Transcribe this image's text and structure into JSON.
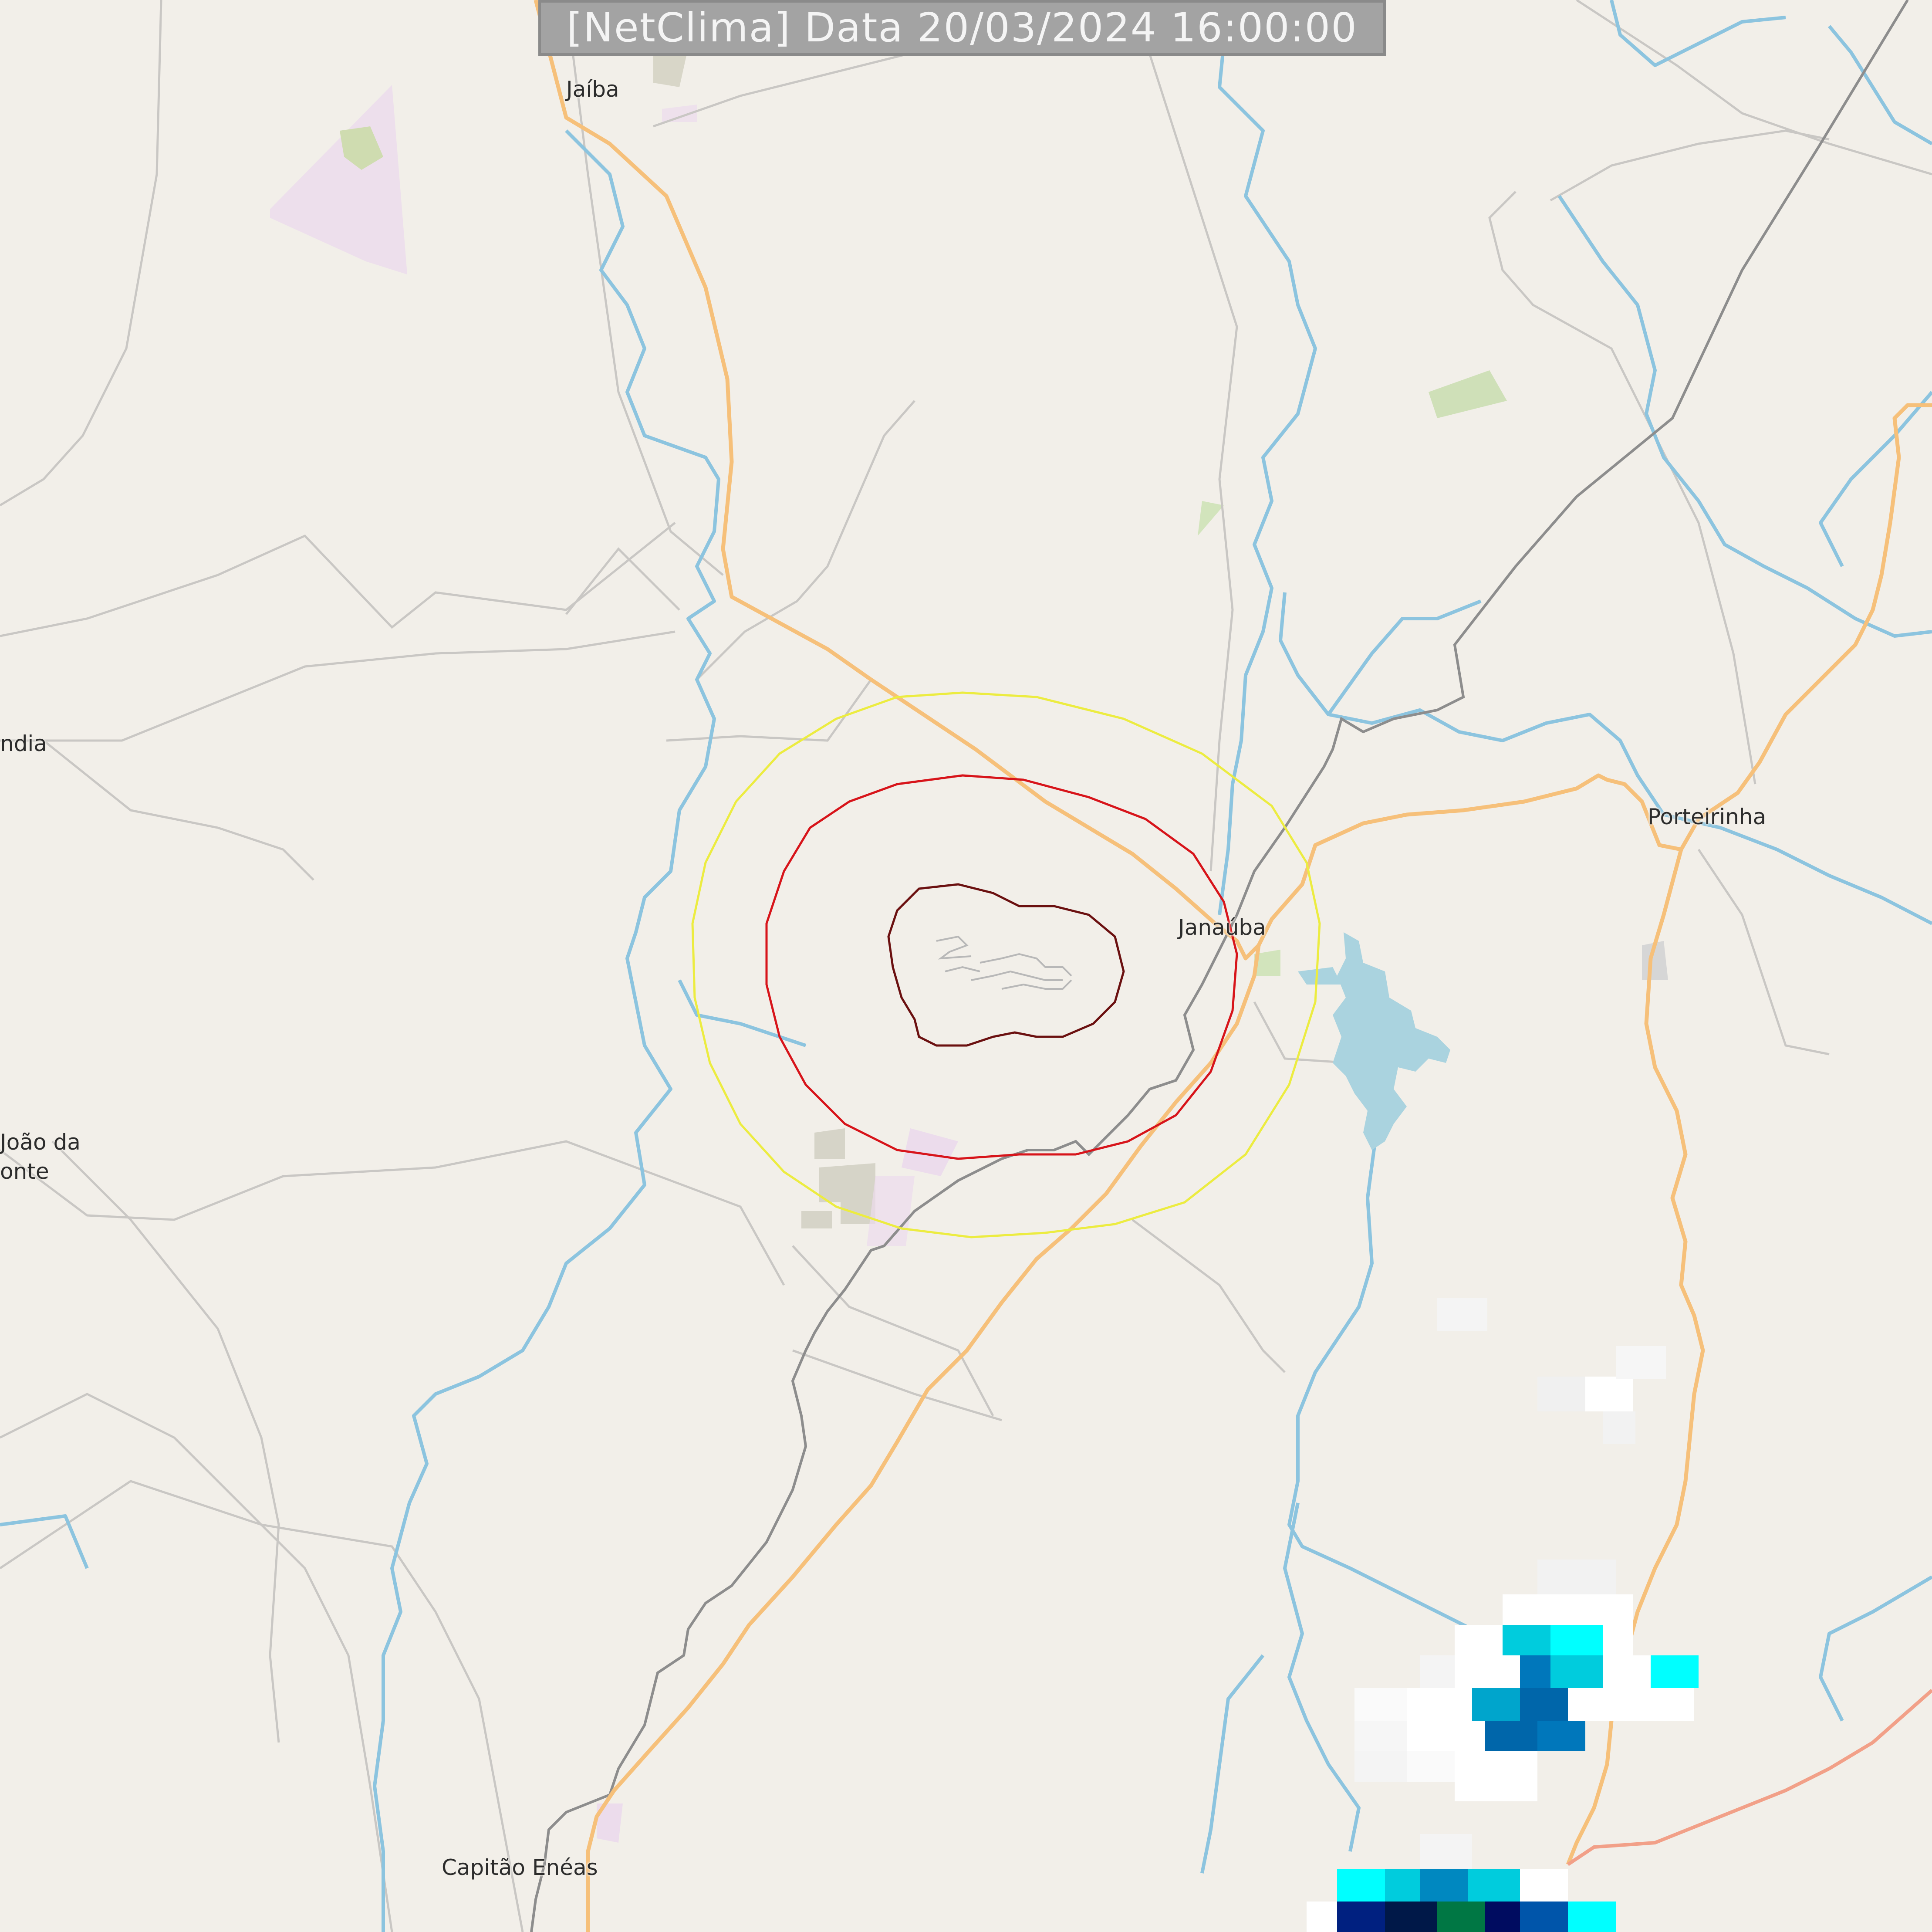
{
  "header": {
    "title": "[NetClima] Data 20/03/2024 16:00:00"
  },
  "places": {
    "jaiba": "Jaíba",
    "janauba": "Janaúba",
    "porteirinha": "Porteirinha",
    "capitao_eneas": "Capitão Enéas",
    "left_upper": "ndia",
    "left_lower_1": "João da",
    "left_lower_2": "onte"
  },
  "colors": {
    "land": "#f2efe9",
    "water": "#aad3df",
    "river": "#8cc3e0",
    "primary_road": "#f6c07a",
    "trunk_road": "#f4a58a",
    "railway": "#8a8a8a",
    "minor_road": "#c8c6c3",
    "contour_outer": "#ecec40",
    "contour_middle": "#d7141a",
    "contour_inner": "#6b1010"
  },
  "radar_legend_colors": [
    "#ffffff",
    "#f0f0f0",
    "#00ffff",
    "#00ccdd",
    "#00a5cc",
    "#0077bb",
    "#0055aa",
    "#002080",
    "#001060",
    "#007744"
  ]
}
